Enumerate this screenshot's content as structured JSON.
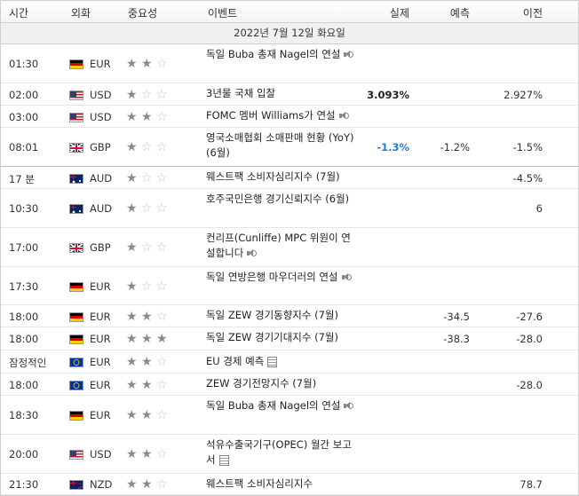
{
  "headers": {
    "time": "시간",
    "currency": "외화",
    "importance": "중요성",
    "event": "이벤트",
    "actual": "실제",
    "forecast": "예측",
    "previous": "이전"
  },
  "date": "2022년 7월 12일 화요일",
  "colors": {
    "actual_negative_blue": "#1f7fd8",
    "star_on": "#8a8a8a",
    "star_off": "#c4c4c4"
  },
  "rows": [
    {
      "time": "01:30",
      "flag": "germany-flag",
      "currency": "EUR",
      "stars": 2,
      "event": "독일 Buba 총재 Nagel의 연설",
      "icon": "speaker-icon",
      "actual": "",
      "forecast": "",
      "previous": ""
    },
    {
      "time": "02:00",
      "flag": "usa-flag",
      "currency": "USD",
      "stars": 1,
      "event": "3년물 국채 입찰",
      "icon": "",
      "actual": "3.093%",
      "forecast": "",
      "previous": "2.927%"
    },
    {
      "time": "03:00",
      "flag": "usa-flag",
      "currency": "USD",
      "stars": 2,
      "event": "FOMC 멤버 Williams가 연설",
      "icon": "speaker-icon",
      "actual": "",
      "forecast": "",
      "previous": ""
    },
    {
      "time": "08:01",
      "flag": "uk-flag",
      "currency": "GBP",
      "stars": 1,
      "event": "영국소매협회 소매판매 현황 (YoY) (6월)",
      "icon": "",
      "actual": "-1.3%",
      "forecast": "-1.2%",
      "previous": "-1.5%"
    },
    {
      "time": "17 분",
      "flag": "australia-flag",
      "currency": "AUD",
      "stars": 1,
      "event": "웨스트팩 소비자심리지수 (7월)",
      "icon": "",
      "actual": "",
      "forecast": "",
      "previous": "-4.5%"
    },
    {
      "time": "10:30",
      "flag": "australia-flag",
      "currency": "AUD",
      "stars": 1,
      "event": "호주국민은행 경기신뢰지수 (6월)",
      "icon": "",
      "actual": "",
      "forecast": "",
      "previous": "6"
    },
    {
      "time": "17:00",
      "flag": "uk-flag",
      "currency": "GBP",
      "stars": 1,
      "event": "컨리프(Cunliffe) MPC 위원이 연설합니다",
      "icon": "speaker-icon",
      "actual": "",
      "forecast": "",
      "previous": ""
    },
    {
      "time": "17:30",
      "flag": "germany-flag",
      "currency": "EUR",
      "stars": 1,
      "event": "독일 연방은행 마우더러의 연설",
      "icon": "speaker-icon",
      "actual": "",
      "forecast": "",
      "previous": ""
    },
    {
      "time": "18:00",
      "flag": "germany-flag",
      "currency": "EUR",
      "stars": 2,
      "event": "독일 ZEW 경기동향지수 (7월)",
      "icon": "",
      "actual": "",
      "forecast": "-34.5",
      "previous": "-27.6"
    },
    {
      "time": "18:00",
      "flag": "germany-flag",
      "currency": "EUR",
      "stars": 3,
      "event": "독일 ZEW 경기기대지수 (7월)",
      "icon": "",
      "actual": "",
      "forecast": "-38.3",
      "previous": "-28.0"
    },
    {
      "time": "잠정적인",
      "flag": "eu-flag",
      "currency": "EUR",
      "stars": 2,
      "event": "EU 경제 예측",
      "icon": "document-icon",
      "actual": "",
      "forecast": "",
      "previous": ""
    },
    {
      "time": "18:00",
      "flag": "eu-flag",
      "currency": "EUR",
      "stars": 2,
      "event": "ZEW 경기전망지수 (7월)",
      "icon": "",
      "actual": "",
      "forecast": "",
      "previous": "-28.0"
    },
    {
      "time": "18:30",
      "flag": "germany-flag",
      "currency": "EUR",
      "stars": 2,
      "event": "독일 Buba 총재 Nagel의 연설",
      "icon": "speaker-icon",
      "actual": "",
      "forecast": "",
      "previous": ""
    },
    {
      "time": "20:00",
      "flag": "usa-flag",
      "currency": "USD",
      "stars": 2,
      "event": "석유수출국기구(OPEC) 월간 보고서",
      "icon": "document-icon",
      "actual": "",
      "forecast": "",
      "previous": ""
    },
    {
      "time": "21:30",
      "flag": "new-zealand-flag",
      "currency": "NZD",
      "stars": 2,
      "event": "웨스트팩 소비자심리지수",
      "icon": "",
      "actual": "",
      "forecast": "",
      "previous": "78.7"
    }
  ]
}
